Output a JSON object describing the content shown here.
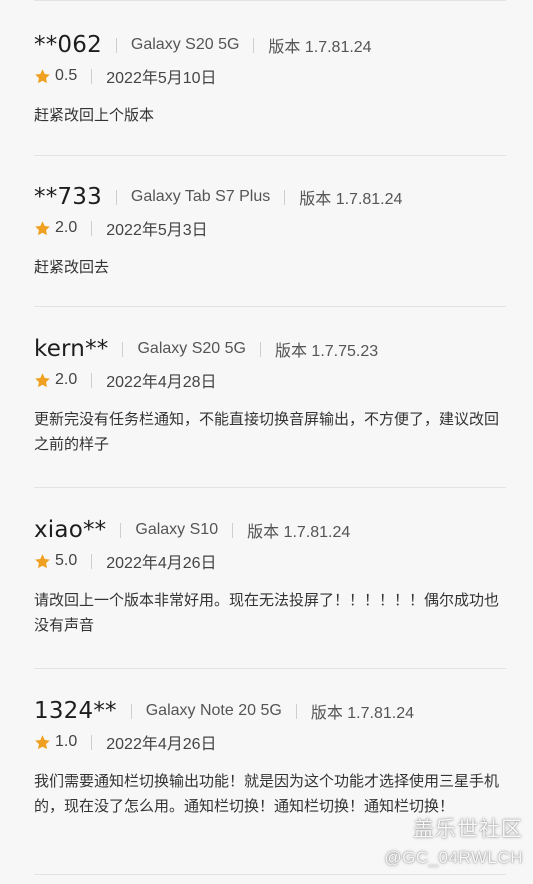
{
  "reviews": [
    {
      "user": "**062",
      "device": "Galaxy S20 5G",
      "version": "版本 1.7.81.24",
      "rating": "0.5",
      "date": "2022年5月10日",
      "text": "赶紧改回上个版本"
    },
    {
      "user": "**733",
      "device": "Galaxy Tab S7 Plus",
      "version": "版本 1.7.81.24",
      "rating": "2.0",
      "date": "2022年5月3日",
      "text": "赶紧改回去"
    },
    {
      "user": "kern**",
      "device": "Galaxy S20 5G",
      "version": "版本 1.7.75.23",
      "rating": "2.0",
      "date": "2022年4月28日",
      "text": "更新完没有任务栏通知，不能直接切换音屏输出，不方便了，建议改回之前的样子"
    },
    {
      "user": "xiao**",
      "device": "Galaxy S10",
      "version": "版本 1.7.81.24",
      "rating": "5.0",
      "date": "2022年4月26日",
      "text": "请改回上一个版本非常好用。现在无法投屏了！！！！！！偶尔成功也没有声音"
    },
    {
      "user": "1324**",
      "device": "Galaxy Note 20 5G",
      "version": "版本 1.7.81.24",
      "rating": "1.0",
      "date": "2022年4月26日",
      "text": "我们需要通知栏切换输出功能！就是因为这个功能才选择使用三星手机的，现在没了怎么用。通知栏切换！通知栏切换！通知栏切换！"
    }
  ],
  "watermark": {
    "title": "盖乐世社区",
    "handle": "@GC_04RWLCH"
  },
  "colors": {
    "star": "#f0a020",
    "background": "#f7f7f7",
    "divider": "#e3e3e3"
  },
  "icons": {
    "rating": "star-icon"
  }
}
